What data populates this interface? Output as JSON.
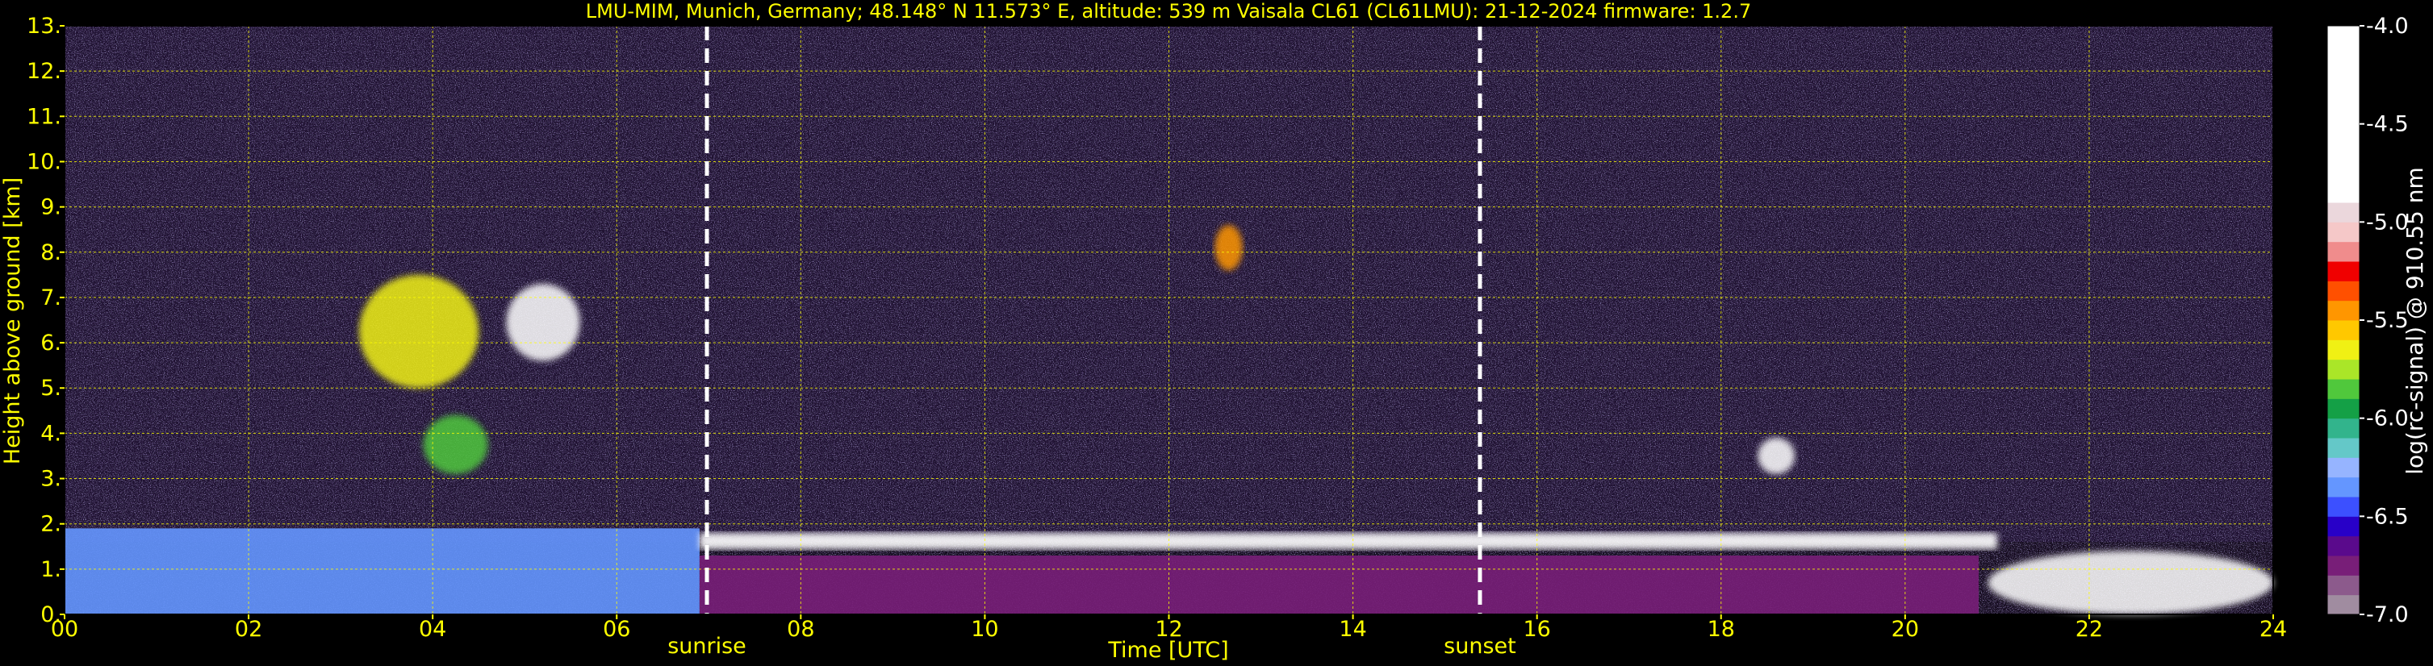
{
  "chart_data": {
    "type": "heatmap",
    "title": "LMU-MIM, Munich, Germany; 48.148° N 11.573° E, altitude: 539 m    Vaisala CL61 (CL61LMU): 21-12-2024    firmware: 1.2.7",
    "xlabel": "Time [UTC]",
    "ylabel": "Height above ground [km]",
    "xlim": [
      0,
      24
    ],
    "ylim": [
      0,
      13
    ],
    "xticks": [
      {
        "value": 0,
        "label": "00"
      },
      {
        "value": 2,
        "label": "02"
      },
      {
        "value": 4,
        "label": "04"
      },
      {
        "value": 6,
        "label": "06"
      },
      {
        "value": 8,
        "label": "08"
      },
      {
        "value": 10,
        "label": "10"
      },
      {
        "value": 12,
        "label": "12"
      },
      {
        "value": 14,
        "label": "14"
      },
      {
        "value": 16,
        "label": "16"
      },
      {
        "value": 18,
        "label": "18"
      },
      {
        "value": 20,
        "label": "20"
      },
      {
        "value": 22,
        "label": "22"
      },
      {
        "value": 24,
        "label": "24"
      }
    ],
    "yticks": [
      {
        "value": 0,
        "label": "0."
      },
      {
        "value": 1,
        "label": "1."
      },
      {
        "value": 2,
        "label": "2."
      },
      {
        "value": 3,
        "label": "3."
      },
      {
        "value": 4,
        "label": "4."
      },
      {
        "value": 5,
        "label": "5."
      },
      {
        "value": 6,
        "label": "6."
      },
      {
        "value": 7,
        "label": "7."
      },
      {
        "value": 8,
        "label": "8."
      },
      {
        "value": 9,
        "label": "9."
      },
      {
        "value": 10,
        "label": "10."
      },
      {
        "value": 11,
        "label": "11."
      },
      {
        "value": 12,
        "label": "12."
      },
      {
        "value": 13,
        "label": "13."
      }
    ],
    "grid": true,
    "annotations": [
      {
        "label": "sunrise",
        "x": 6.98
      },
      {
        "label": "sunset",
        "x": 15.38
      }
    ],
    "colorbar": {
      "label": "log(rc-signal) @ 910.55 nm",
      "range": [
        -7.0,
        -4.0
      ],
      "ticks": [
        {
          "value": -4.0,
          "label": "-4.0"
        },
        {
          "value": -4.5,
          "label": "-4.5"
        },
        {
          "value": -5.0,
          "label": "-5.0"
        },
        {
          "value": -5.5,
          "label": "-5.5"
        },
        {
          "value": -6.0,
          "label": "-6.0"
        },
        {
          "value": -6.5,
          "label": "-6.5"
        },
        {
          "value": -7.0,
          "label": "-7.0"
        }
      ],
      "colors": [
        {
          "from": -7.0,
          "to": -6.9,
          "color": "#a08ca0"
        },
        {
          "from": -6.9,
          "to": -6.8,
          "color": "#8c5a8c"
        },
        {
          "from": -6.8,
          "to": -6.7,
          "color": "#781e78"
        },
        {
          "from": -6.7,
          "to": -6.6,
          "color": "#5a0a8c"
        },
        {
          "from": -6.6,
          "to": -6.5,
          "color": "#2800c8"
        },
        {
          "from": -6.5,
          "to": -6.4,
          "color": "#3c50ff"
        },
        {
          "from": -6.4,
          "to": -6.3,
          "color": "#6496ff"
        },
        {
          "from": -6.3,
          "to": -6.2,
          "color": "#96b4ff"
        },
        {
          "from": -6.2,
          "to": -6.1,
          "color": "#64c8c8"
        },
        {
          "from": -6.1,
          "to": -6.0,
          "color": "#32b48c"
        },
        {
          "from": -6.0,
          "to": -5.9,
          "color": "#14a046"
        },
        {
          "from": -5.9,
          "to": -5.8,
          "color": "#50c83c"
        },
        {
          "from": -5.8,
          "to": -5.7,
          "color": "#aae628"
        },
        {
          "from": -5.7,
          "to": -5.6,
          "color": "#f0f014"
        },
        {
          "from": -5.6,
          "to": -5.5,
          "color": "#ffc800"
        },
        {
          "from": -5.5,
          "to": -5.4,
          "color": "#ff9600"
        },
        {
          "from": -5.4,
          "to": -5.3,
          "color": "#ff5000"
        },
        {
          "from": -5.3,
          "to": -5.2,
          "color": "#f00000"
        },
        {
          "from": -5.2,
          "to": -5.1,
          "color": "#f08c8c"
        },
        {
          "from": -5.1,
          "to": -5.0,
          "color": "#f5c8c8"
        },
        {
          "from": -5.0,
          "to": -4.9,
          "color": "#ebd7dc"
        },
        {
          "from": -4.9,
          "to": -4.0,
          "color": "#ffffff"
        }
      ]
    },
    "features": [
      {
        "kind": "boundary_layer",
        "x": [
          0,
          6.9
        ],
        "y": [
          0,
          1.9
        ],
        "color": "#6496ff"
      },
      {
        "kind": "boundary_layer",
        "x": [
          6.9,
          20.8
        ],
        "y": [
          0,
          1.3
        ],
        "color": "#781e78"
      },
      {
        "kind": "cloud_base_layer",
        "x": [
          6.9,
          21
        ],
        "y": [
          1.0,
          1.8
        ],
        "color": "#ffffff"
      },
      {
        "kind": "cloud",
        "x": [
          3.2,
          4.5
        ],
        "y": [
          5.0,
          7.5
        ],
        "color": "#f0f014"
      },
      {
        "kind": "cloud",
        "x": [
          4.8,
          5.6
        ],
        "y": [
          5.6,
          7.3
        ],
        "color": "#ffffff"
      },
      {
        "kind": "cloud",
        "x": [
          3.9,
          4.6
        ],
        "y": [
          3.1,
          4.4
        ],
        "color": "#50c83c"
      },
      {
        "kind": "cloud",
        "x": [
          12.5,
          12.8
        ],
        "y": [
          7.6,
          8.6
        ],
        "color": "#ff9600"
      },
      {
        "kind": "cloud",
        "x": [
          18.4,
          18.8
        ],
        "y": [
          3.1,
          3.9
        ],
        "color": "#ffffff"
      },
      {
        "kind": "cloud",
        "x": [
          20.9,
          24
        ],
        "y": [
          0,
          1.4
        ],
        "color": "#ffffff"
      }
    ]
  }
}
